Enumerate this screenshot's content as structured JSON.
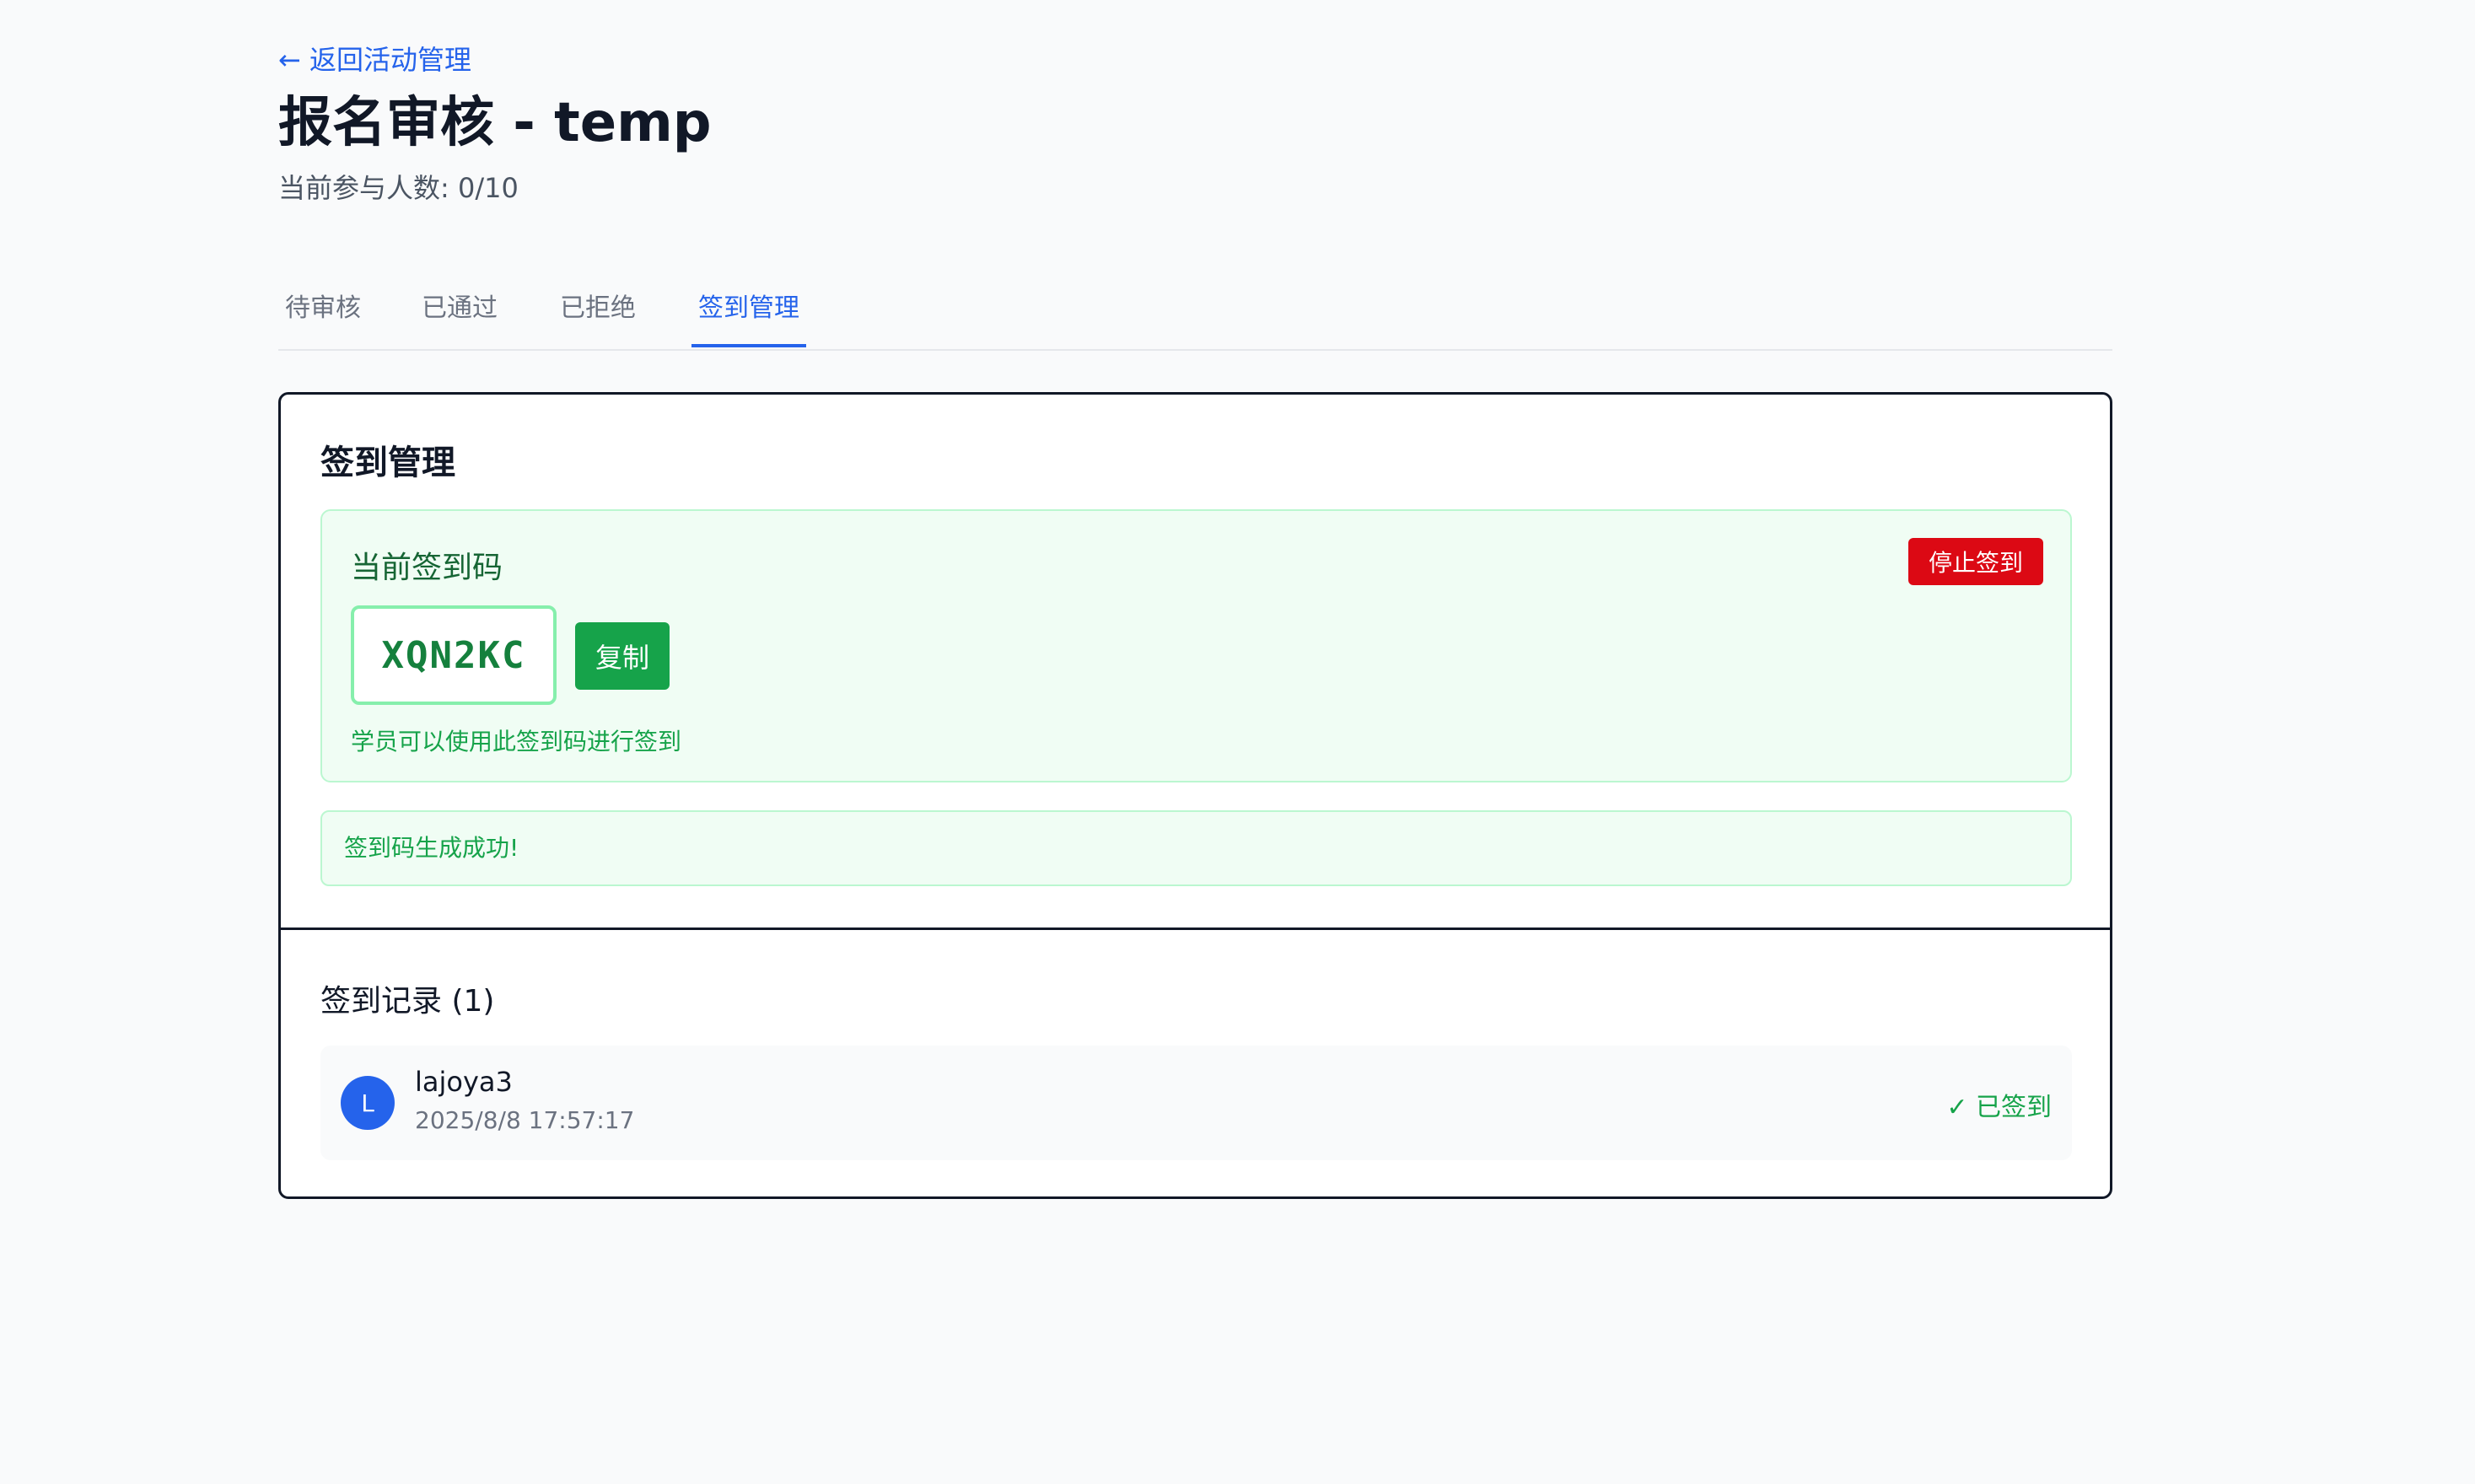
{
  "header": {
    "back_link": "← 返回活动管理",
    "title": "报名审核 - temp",
    "participants": "当前参与人数: 0/10"
  },
  "tabs": [
    {
      "label": "待审核",
      "active": false
    },
    {
      "label": "已通过",
      "active": false
    },
    {
      "label": "已拒绝",
      "active": false
    },
    {
      "label": "签到管理",
      "active": true
    }
  ],
  "checkin": {
    "section_title": "签到管理",
    "current_code_label": "当前签到码",
    "stop_button": "停止签到",
    "code": "XQN2KC",
    "copy_button": "复制",
    "hint": "学员可以使用此签到码进行签到",
    "success_message": "签到码生成成功!"
  },
  "records": {
    "title": "签到记录 (1)",
    "items": [
      {
        "initial": "L",
        "name": "lajoya3",
        "time": "2025/8/8 17:57:17",
        "status": "✓ 已签到"
      }
    ]
  },
  "colors": {
    "accent": "#2563eb",
    "success": "#16a34a",
    "danger": "#dc0914",
    "success_bg": "#f0fdf4"
  }
}
